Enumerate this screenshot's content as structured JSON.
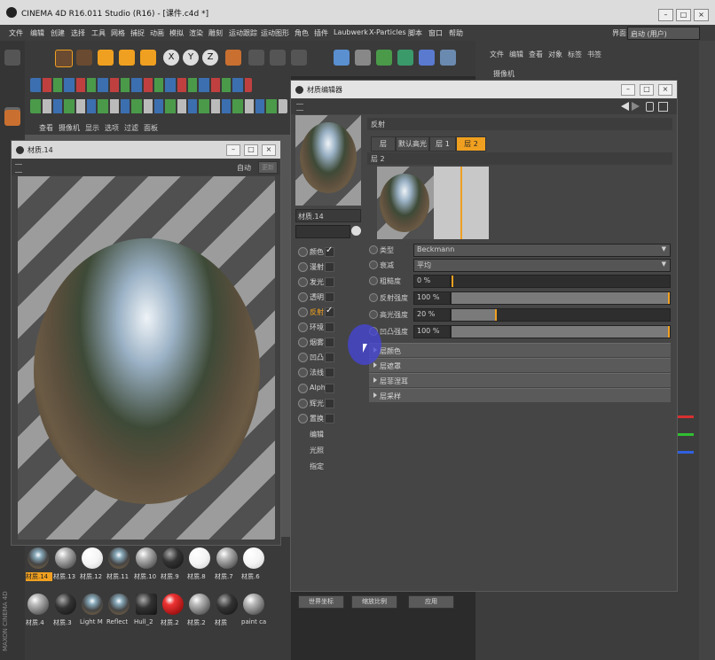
{
  "app": {
    "title": "CINEMA 4D R16.011 Studio (R16) - [课件.c4d *]",
    "layout_label": "界面:",
    "layout_value": "启动 (用户)"
  },
  "menu": [
    "文件",
    "编辑",
    "创建",
    "选择",
    "工具",
    "网格",
    "捕捉",
    "动画",
    "模拟",
    "渲染",
    "雕刻",
    "运动跟踪",
    "运动图形",
    "角色",
    "插件",
    "Laubwerk",
    "X-Particles",
    "脚本",
    "窗口",
    "帮助"
  ],
  "right_panel_menu": [
    "文件",
    "编辑",
    "查看",
    "对象",
    "标签",
    "书签"
  ],
  "right_panel_item": "摄像机",
  "viewport_menu": [
    "查看",
    "摄像机",
    "显示",
    "选项",
    "过滤",
    "面板"
  ],
  "preview_window": {
    "title": "材质.14",
    "auto_label": "自动",
    "refresh_label": "更新"
  },
  "material_editor": {
    "title": "材质编辑器",
    "material_name": "材质.14",
    "section_title": "反射",
    "tabs": [
      "层",
      "默认高光",
      "层 1",
      "层 2"
    ],
    "active_tab": "层 2",
    "layer_title": "层 2",
    "channels": [
      {
        "label": "颜色",
        "checked": true
      },
      {
        "label": "漫射",
        "checked": false
      },
      {
        "label": "发光",
        "checked": false
      },
      {
        "label": "透明",
        "checked": false
      },
      {
        "label": "反射",
        "checked": true,
        "active": true
      },
      {
        "label": "环境",
        "checked": false
      },
      {
        "label": "烟雾",
        "checked": false
      },
      {
        "label": "凹凸",
        "checked": false
      },
      {
        "label": "法线",
        "checked": false
      },
      {
        "label": "Alpha",
        "checked": false
      },
      {
        "label": "辉光",
        "checked": false
      },
      {
        "label": "置换",
        "checked": false
      },
      {
        "label": "编辑"
      },
      {
        "label": "光照"
      },
      {
        "label": "指定"
      }
    ],
    "params": {
      "type_label": "类型",
      "type_value": "Beckmann",
      "atten_label": "衰减",
      "atten_value": "平均",
      "rough_label": "粗糙度",
      "rough_value": "0 %",
      "rough_fraction": 0.0,
      "refl_label": "反射强度",
      "refl_value": "100 %",
      "refl_fraction": 1.0,
      "spec_label": "高光强度",
      "spec_value": "20 %",
      "spec_fraction": 0.2,
      "bump_label": "凹凸强度",
      "bump_value": "100 %",
      "bump_fraction": 1.0
    },
    "folds": [
      "层颜色",
      "层遮罩",
      "层菲涅耳",
      "层采样"
    ]
  },
  "materials_row1": [
    "材质.14",
    "材质.13",
    "材质.12",
    "材质.11",
    "材质.10",
    "材质.9",
    "材质.8",
    "材质.7",
    "材质.6"
  ],
  "materials_row2": [
    "材质.4",
    "材质.3",
    "Light M",
    "Reflect",
    "Hull_2",
    "材质.2",
    "材质.2",
    "材质",
    "paint ca"
  ],
  "bottom_buttons": [
    "世界坐标",
    "缩放比例",
    "应用"
  ],
  "branding": "MAXON CINEMA 4D",
  "colors": {
    "accent": "#f0a020"
  }
}
